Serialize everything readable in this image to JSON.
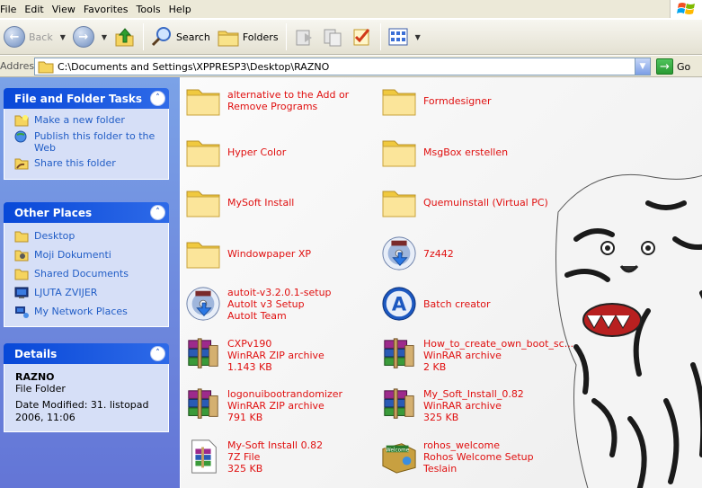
{
  "menu": [
    "File",
    "Edit",
    "View",
    "Favorites",
    "Tools",
    "Help"
  ],
  "toolbar": {
    "back_label": "Back",
    "search_label": "Search",
    "folders_label": "Folders"
  },
  "address": {
    "label": "Address",
    "path": "C:\\Documents and Settings\\XPPRESP3\\Desktop\\RAZNO",
    "go_label": "Go"
  },
  "tasks_panel": {
    "title": "File and Folder Tasks",
    "items": [
      {
        "label": "Make a new folder",
        "icon": "new-folder-icon"
      },
      {
        "label": "Publish this folder to the Web",
        "icon": "publish-web-icon"
      },
      {
        "label": "Share this folder",
        "icon": "share-folder-icon"
      }
    ]
  },
  "places_panel": {
    "title": "Other Places",
    "items": [
      {
        "label": "Desktop",
        "icon": "folder-icon"
      },
      {
        "label": "Moji Dokumenti",
        "icon": "documents-icon"
      },
      {
        "label": "Shared Documents",
        "icon": "folder-icon"
      },
      {
        "label": "LJUTA ZVIJER",
        "icon": "computer-icon"
      },
      {
        "label": "My Network Places",
        "icon": "network-icon"
      }
    ]
  },
  "details_panel": {
    "title": "Details",
    "name": "RAZNO",
    "type": "File Folder",
    "modified_line1": "Date Modified: 31. listopad",
    "modified_line2": "2006, 11:06"
  },
  "files": [
    {
      "lines": [
        "alternative to the Add or",
        "Remove Programs"
      ],
      "icon": "folder"
    },
    {
      "lines": [
        "Formdesigner"
      ],
      "icon": "folder"
    },
    {
      "lines": [
        "Hyper Color"
      ],
      "icon": "folder"
    },
    {
      "lines": [
        "MsgBox erstellen"
      ],
      "icon": "folder"
    },
    {
      "lines": [
        "MySoft Install"
      ],
      "icon": "folder"
    },
    {
      "lines": [
        "Quemuinstall (Virtual PC)"
      ],
      "icon": "folder"
    },
    {
      "lines": [
        "Windowpaper XP"
      ],
      "icon": "folder"
    },
    {
      "lines": [
        "7z442"
      ],
      "icon": "installer-cd"
    },
    {
      "lines": [
        "autoit-v3.2.0.1-setup",
        "AutoIt v3 Setup",
        "AutoIt Team"
      ],
      "icon": "installer-cd"
    },
    {
      "lines": [
        "Batch creator"
      ],
      "icon": "app-a"
    },
    {
      "lines": [
        "CXPv190",
        "WinRAR ZIP archive",
        "1.143 KB"
      ],
      "icon": "winrar"
    },
    {
      "lines": [
        "How_to_create_own_boot_sc...",
        "WinRAR archive",
        "2 KB"
      ],
      "icon": "winrar"
    },
    {
      "lines": [
        "logonuibootrandomizer",
        "WinRAR ZIP archive",
        "791 KB"
      ],
      "icon": "winrar"
    },
    {
      "lines": [
        "My_Soft_Install_0.82",
        "WinRAR archive",
        "325 KB"
      ],
      "icon": "winrar"
    },
    {
      "lines": [
        "My-Soft Install 0.82",
        "7Z File",
        "325 KB"
      ],
      "icon": "sevenz-file"
    },
    {
      "lines": [
        "rohos_welcome",
        "Rohos Welcome Setup",
        "Teslain"
      ],
      "icon": "welcome-box"
    }
  ]
}
